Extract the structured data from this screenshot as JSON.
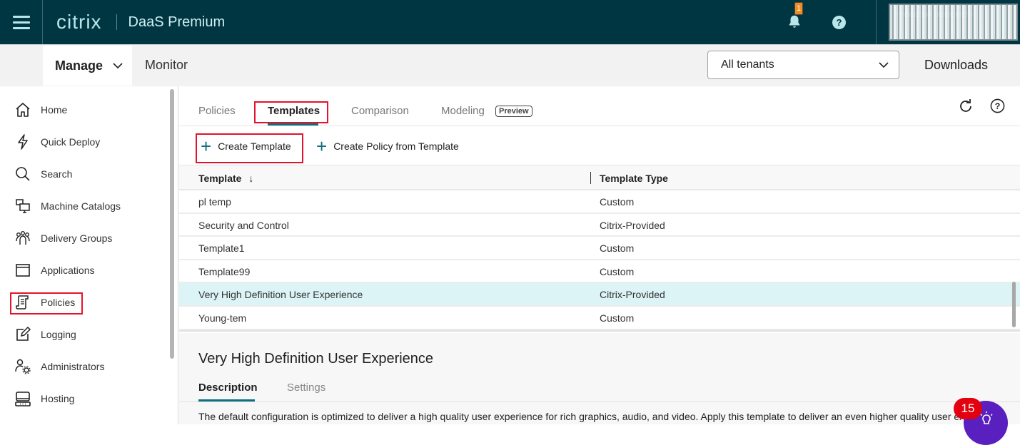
{
  "topbar": {
    "brand": "citrix",
    "product": "DaaS Premium",
    "notification_count": "1",
    "help_label": "?",
    "user_display": "[redacted user name]"
  },
  "subnav": {
    "manage_label": "Manage",
    "monitor_label": "Monitor",
    "tenant_selected": "All tenants",
    "downloads_label": "Downloads"
  },
  "sidebar": {
    "items": [
      {
        "label": "Home",
        "icon": "home-icon"
      },
      {
        "label": "Quick Deploy",
        "icon": "lightning-icon"
      },
      {
        "label": "Search",
        "icon": "search-icon"
      },
      {
        "label": "Machine Catalogs",
        "icon": "machine-catalogs-icon"
      },
      {
        "label": "Delivery Groups",
        "icon": "delivery-groups-icon"
      },
      {
        "label": "Applications",
        "icon": "applications-icon"
      },
      {
        "label": "Policies",
        "icon": "policies-icon",
        "active": true
      },
      {
        "label": "Logging",
        "icon": "logging-icon"
      },
      {
        "label": "Administrators",
        "icon": "administrators-icon"
      },
      {
        "label": "Hosting",
        "icon": "hosting-icon"
      }
    ]
  },
  "main": {
    "tabs": [
      {
        "label": "Policies"
      },
      {
        "label": "Templates",
        "active": true
      },
      {
        "label": "Comparison"
      },
      {
        "label": "Modeling",
        "badge": "Preview"
      }
    ],
    "toolbar": {
      "create_template": "Create Template",
      "create_policy_from_template": "Create Policy from Template"
    },
    "table": {
      "columns": [
        "Template",
        "Template Type"
      ],
      "sort_indicator": "↓",
      "rows": [
        {
          "template": "pl temp",
          "type": "Custom"
        },
        {
          "template": "Security and Control",
          "type": "Citrix-Provided"
        },
        {
          "template": "Template1",
          "type": "Custom"
        },
        {
          "template": "Template99",
          "type": "Custom"
        },
        {
          "template": "Very High Definition User Experience",
          "type": "Citrix-Provided",
          "selected": true
        },
        {
          "template": "Young-tem",
          "type": "Custom"
        }
      ]
    },
    "splitter_handle": "......",
    "detail": {
      "title": "Very High Definition User Experience",
      "tabs": [
        {
          "label": "Description",
          "active": true
        },
        {
          "label": "Settings"
        }
      ],
      "description": "The default configuration is optimized to deliver a high quality user experience for rich graphics, audio, and video. Apply this template to deliver an even higher quality user experience"
    }
  },
  "fab": {
    "badge_count": "15",
    "icon": "lightbulb-icon"
  },
  "colors": {
    "topbar_bg": "#003641",
    "accent": "#0f6f7e",
    "highlight_box": "#e3132b",
    "selected_row": "#dcf4f6",
    "fab_bg": "#5a1fbf",
    "fab_badge": "#e3000f",
    "notification_badge": "#f28c1f"
  }
}
